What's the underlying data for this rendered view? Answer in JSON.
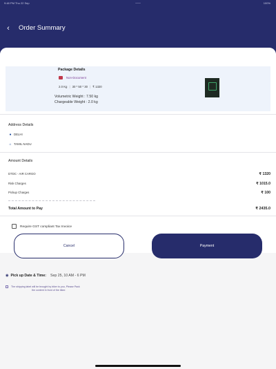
{
  "statusbar": {
    "time_date": "9:48 PM  Thu 22 Sep",
    "battery": "100%"
  },
  "header": {
    "title": "Order Summary"
  },
  "package": {
    "title": "Package Details",
    "type": "Non-Document",
    "weight": "2.0 Kg",
    "dimensions": "30 * 50 * 30",
    "price": "₹ 1320",
    "volumetric": "Volumetric Weight : 7.50 kg",
    "chargeable": "Chargeable Weight : 2.0 kg"
  },
  "address": {
    "title": "Address Details",
    "from": "DELHI",
    "to": "TAMIL NADU"
  },
  "amount": {
    "title": "Amount Details",
    "rows": [
      {
        "label": "DTDC - AIR CARGO",
        "value": "₹ 1320"
      },
      {
        "label": "Risk Charges",
        "value": "₹ 1015.0"
      },
      {
        "label": "Pickup Charges",
        "value": "₹ 100"
      }
    ],
    "total_label": "Total Amount to Pay",
    "total_value": "₹ 2435.0"
  },
  "gst_label": "Require GST compliant Tax Invoice",
  "buttons": {
    "cancel": "Cancel",
    "payment": "Payment"
  },
  "pickup": {
    "label": "Pick up Date & Time:",
    "value": "Sep 25,  10 AM - 6 PM"
  },
  "note": {
    "line1": "The shipping label will be brought by biker to you, Please Pack",
    "line2": "the content in front of the biker."
  },
  "colors": {
    "brand": "#262c6b",
    "accent_purple": "#7a3a94",
    "package_bg": "#eef3fb"
  },
  "icons": {
    "back": "chevron-left-icon",
    "package_type": "briefcase-icon",
    "from": "pin-icon",
    "to": "home-icon",
    "pickup": "location-icon",
    "note": "info-icon"
  }
}
